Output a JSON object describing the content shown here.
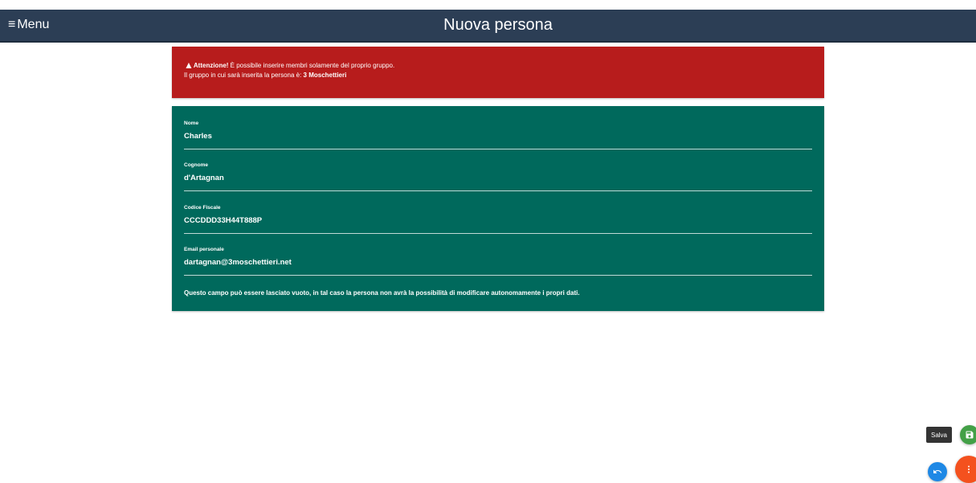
{
  "header": {
    "menu_icon": "hamburger-icon",
    "menu_label": "Menu",
    "title": "Nuova persona",
    "bg_color": "#2c3e55"
  },
  "alert": {
    "icon": "warning-icon",
    "title": "Attenzione!",
    "line1_text": " È possibile inserire membri solamente del proprio gruppo.",
    "line2_prefix": "Il gruppo in cui sarà inserita la persona è: ",
    "group_name": "3 Moschettieri",
    "bg_color": "#b71c1c"
  },
  "form": {
    "bg_color": "#00695c",
    "fields": [
      {
        "label": "Nome",
        "value": "Charles"
      },
      {
        "label": "Cognome",
        "value": "d'Artagnan"
      },
      {
        "label": "Codice Fiscale",
        "value": "CCCDDD33H44T888P"
      },
      {
        "label": "Email personale",
        "value": "dartagnan@3moschettieri.net"
      }
    ],
    "hint": "Questo campo può essere lasciato vuoto, in tal caso la persona non avrà la possibilità di modificare autonomamente i propri dati."
  },
  "actions": {
    "save_tooltip": "Salva",
    "save_icon": "save-icon",
    "undo_icon": "undo-icon",
    "more_icon": "more-vertical-icon",
    "save_color": "#43a047",
    "undo_color": "#1e88e5",
    "more_color": "#f4511e"
  }
}
